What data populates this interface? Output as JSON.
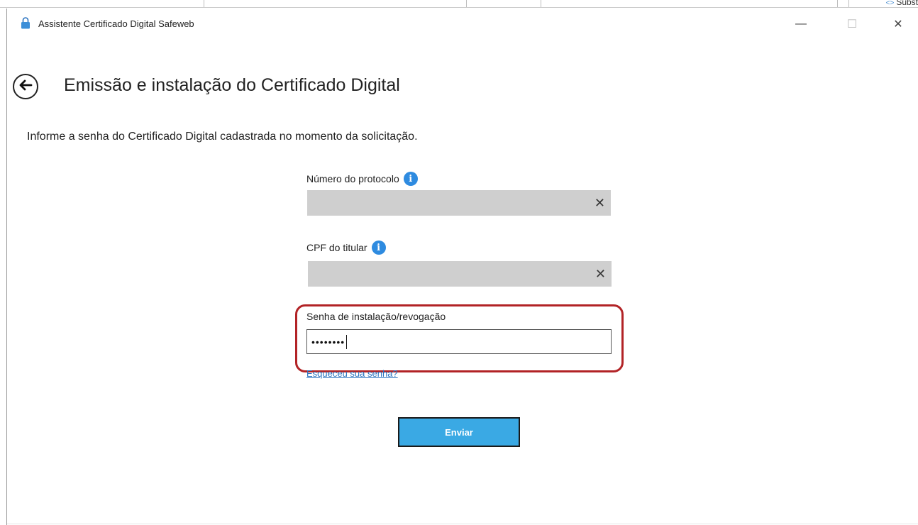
{
  "background": {
    "partial_text": "Subst"
  },
  "window": {
    "title": "Assistente Certificado Digital Safeweb",
    "controls": {
      "minimize": "—",
      "maximize": "☐",
      "close": "✕"
    }
  },
  "page": {
    "title": "Emissão e instalação do Certificado Digital",
    "instruction": "Informe a senha do Certificado Digital cadastrada no momento da solicitação."
  },
  "form": {
    "protocol": {
      "label": "Número do protocolo",
      "value": "",
      "info_icon": "info-icon"
    },
    "cpf": {
      "label": "CPF do titular",
      "value": "",
      "info_icon": "info-icon"
    },
    "password": {
      "label": "Senha de instalação/revogação",
      "masked_value": "••••••••"
    },
    "forgot_link": "Esqueceu sua senha?",
    "submit_label": "Enviar"
  },
  "colors": {
    "highlight": "#b22326",
    "button": "#3aa9e4",
    "info": "#2e8be0",
    "link": "#2a73c0"
  }
}
